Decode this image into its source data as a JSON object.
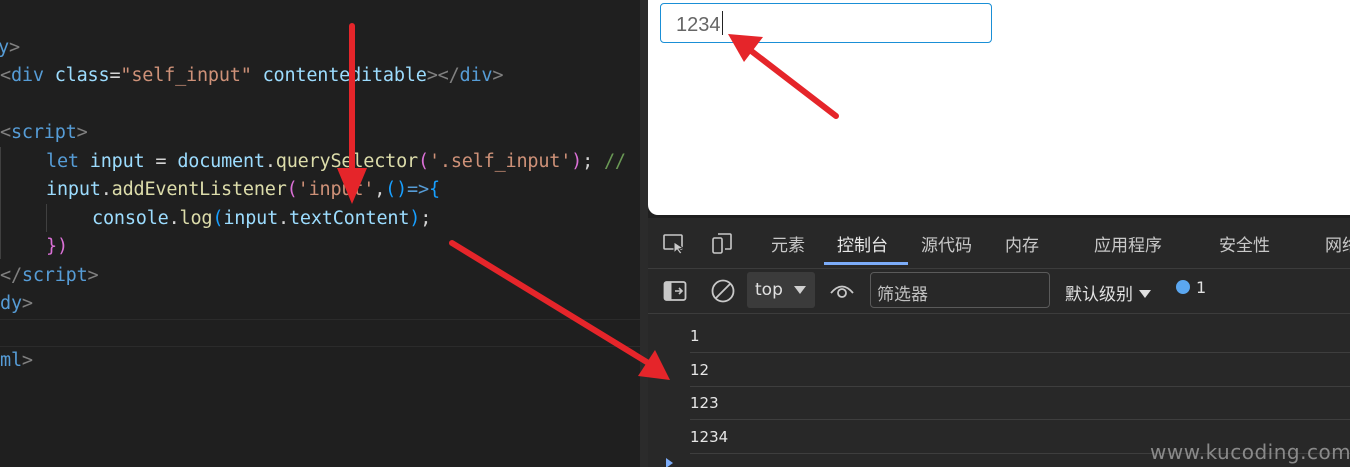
{
  "editor": {
    "lines": [
      {
        "id": "l1",
        "tokens": [
          {
            "t": "y",
            "c": "c-tag"
          },
          {
            "t": ">",
            "c": "c-punc"
          }
        ]
      },
      {
        "id": "l2",
        "tokens": [
          {
            "t": "<",
            "c": "c-punc"
          },
          {
            "t": "div",
            "c": "c-tag"
          },
          {
            "t": " ",
            "c": "c-plain"
          },
          {
            "t": "class",
            "c": "c-attr"
          },
          {
            "t": "=",
            "c": "c-plain"
          },
          {
            "t": "\"self_input\"",
            "c": "c-str"
          },
          {
            "t": " ",
            "c": "c-plain"
          },
          {
            "t": "contenteditable",
            "c": "c-attr"
          },
          {
            "t": "></",
            "c": "c-punc"
          },
          {
            "t": "div",
            "c": "c-tag"
          },
          {
            "t": ">",
            "c": "c-punc"
          }
        ]
      },
      {
        "id": "l3",
        "tokens": []
      },
      {
        "id": "l4",
        "tokens": [
          {
            "t": "<",
            "c": "c-punc"
          },
          {
            "t": "script",
            "c": "c-tag"
          },
          {
            "t": ">",
            "c": "c-punc"
          }
        ]
      },
      {
        "id": "l5",
        "tokens": [
          {
            "t": "let",
            "c": "c-kw"
          },
          {
            "t": " ",
            "c": "c-plain"
          },
          {
            "t": "input",
            "c": "c-var"
          },
          {
            "t": " = ",
            "c": "c-plain"
          },
          {
            "t": "document",
            "c": "c-var"
          },
          {
            "t": ".",
            "c": "c-plain"
          },
          {
            "t": "querySelector",
            "c": "c-fn"
          },
          {
            "t": "(",
            "c": "c-par1"
          },
          {
            "t": "'.self_input'",
            "c": "c-str"
          },
          {
            "t": ")",
            "c": "c-par1"
          },
          {
            "t": ";",
            "c": "c-plain"
          },
          {
            "t": " //",
            "c": "c-com"
          }
        ]
      },
      {
        "id": "l6",
        "tokens": [
          {
            "t": "input",
            "c": "c-var"
          },
          {
            "t": ".",
            "c": "c-plain"
          },
          {
            "t": "addEventListener",
            "c": "c-fn"
          },
          {
            "t": "(",
            "c": "c-par1"
          },
          {
            "t": "'input'",
            "c": "c-str"
          },
          {
            "t": ",",
            "c": "c-plain"
          },
          {
            "t": "()",
            "c": "c-par2"
          },
          {
            "t": "=>",
            "c": "c-kw"
          },
          {
            "t": "{",
            "c": "c-par2"
          }
        ]
      },
      {
        "id": "l7",
        "tokens": [
          {
            "t": "console",
            "c": "c-var"
          },
          {
            "t": ".",
            "c": "c-plain"
          },
          {
            "t": "log",
            "c": "c-fn"
          },
          {
            "t": "(",
            "c": "c-par2"
          },
          {
            "t": "input",
            "c": "c-var"
          },
          {
            "t": ".",
            "c": "c-plain"
          },
          {
            "t": "textContent",
            "c": "c-var"
          },
          {
            "t": ")",
            "c": "c-par2"
          },
          {
            "t": ";",
            "c": "c-plain"
          }
        ]
      },
      {
        "id": "l8",
        "tokens": [
          {
            "t": "})",
            "c": "c-par1"
          }
        ]
      },
      {
        "id": "l9",
        "tokens": [
          {
            "t": "</",
            "c": "c-punc"
          },
          {
            "t": "script",
            "c": "c-tag"
          },
          {
            "t": ">",
            "c": "c-punc"
          }
        ]
      },
      {
        "id": "l10",
        "tokens": [
          {
            "t": "dy",
            "c": "c-tag"
          },
          {
            "t": ">",
            "c": "c-punc"
          }
        ]
      },
      {
        "id": "l11",
        "tokens": []
      },
      {
        "id": "l12",
        "tokens": [
          {
            "t": "ml",
            "c": "c-tag"
          },
          {
            "t": ">",
            "c": "c-punc"
          }
        ]
      }
    ]
  },
  "preview": {
    "input_value": "1234"
  },
  "devtools": {
    "tabs": [
      {
        "id": "elements",
        "label": "元素"
      },
      {
        "id": "console",
        "label": "控制台"
      },
      {
        "id": "sources",
        "label": "源代码"
      },
      {
        "id": "memory",
        "label": "内存"
      },
      {
        "id": "application",
        "label": "应用程序"
      },
      {
        "id": "security",
        "label": "安全性"
      },
      {
        "id": "network",
        "label": "网络"
      }
    ],
    "active_tab": "console",
    "toolbar": {
      "context": "top",
      "filter_placeholder": "筛选器",
      "levels": "默认级别",
      "issues_count": "1"
    },
    "logs": [
      "1",
      "12",
      "123",
      "1234"
    ]
  },
  "watermark": "www.kucoding.com",
  "colors": {
    "arrow": "#e5252a",
    "focus_border": "#1a8fd6",
    "accent": "#7cacf8"
  }
}
